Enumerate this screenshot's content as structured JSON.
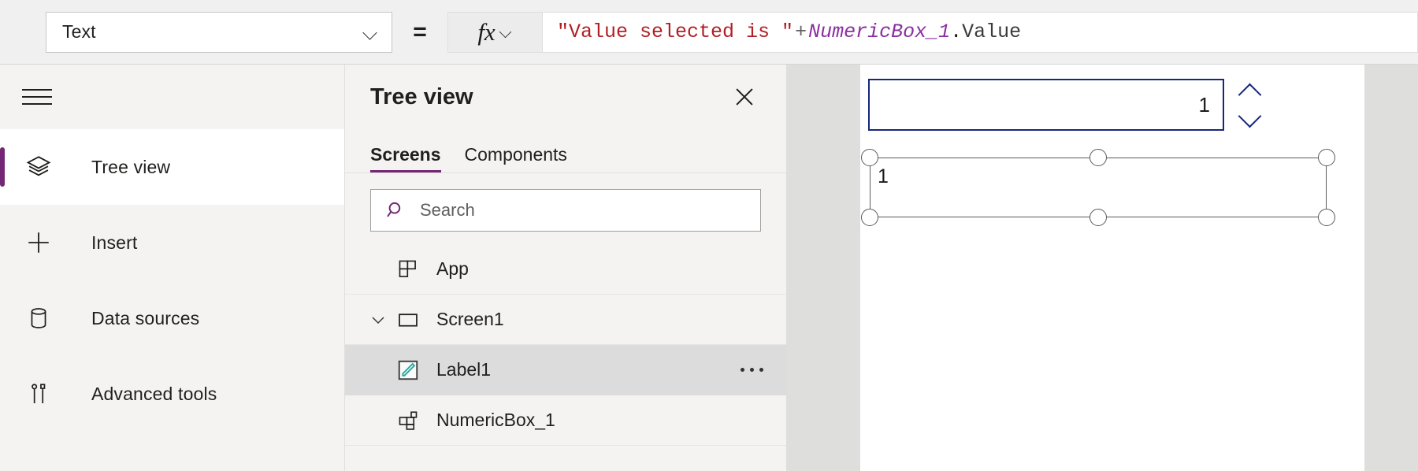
{
  "formula_bar": {
    "property_selected": "Text",
    "property_options": [
      "Text"
    ],
    "equals_sign": "=",
    "fx_label": "fx",
    "formula_tokens": {
      "string_literal": "\"Value selected is \"",
      "operator": "+",
      "control_name": "NumericBox_1",
      "dot": ".",
      "property": "Value"
    },
    "formula_full": "\"Value selected is \" + NumericBox_1.Value"
  },
  "rail": {
    "menu_icon": "hamburger-icon",
    "items": [
      {
        "label": "Tree view",
        "icon": "layers-icon",
        "selected": true
      },
      {
        "label": "Insert",
        "icon": "plus-icon",
        "selected": false
      },
      {
        "label": "Data sources",
        "icon": "database-icon",
        "selected": false
      },
      {
        "label": "Advanced tools",
        "icon": "tools-icon",
        "selected": false
      }
    ]
  },
  "tree_panel": {
    "title": "Tree view",
    "close_icon": "close-icon",
    "tabs": [
      {
        "label": "Screens",
        "active": true
      },
      {
        "label": "Components",
        "active": false
      }
    ],
    "search": {
      "placeholder": "Search",
      "value": "",
      "icon": "search-icon"
    },
    "nodes": [
      {
        "label": "App",
        "icon": "app-icon",
        "level": 0,
        "expandable": false,
        "selected": false,
        "has_menu": false
      },
      {
        "label": "Screen1",
        "icon": "screen-icon",
        "level": 1,
        "expandable": true,
        "expanded": true,
        "selected": false,
        "has_menu": false
      },
      {
        "label": "Label1",
        "icon": "label-pencil-icon",
        "level": 2,
        "expandable": false,
        "selected": true,
        "has_menu": true
      },
      {
        "label": "NumericBox_1",
        "icon": "component-icon",
        "level": 2,
        "expandable": false,
        "selected": false,
        "has_menu": false
      }
    ]
  },
  "canvas": {
    "numeric_box": {
      "value": "1",
      "spinner_up_icon": "chevron-up-icon",
      "spinner_down_icon": "chevron-down-icon"
    },
    "selected_label": {
      "text": "1"
    }
  },
  "colors": {
    "accent_purple": "#742774",
    "formula_string": "#b01f24",
    "formula_control": "#8a2fa0",
    "control_border_navy": "#17277a",
    "label_icon_teal": "#2ba6a0",
    "panel_bg": "#f4f3f2",
    "canvas_bg": "#dededd",
    "selected_row_bg": "#dcdcdc"
  }
}
